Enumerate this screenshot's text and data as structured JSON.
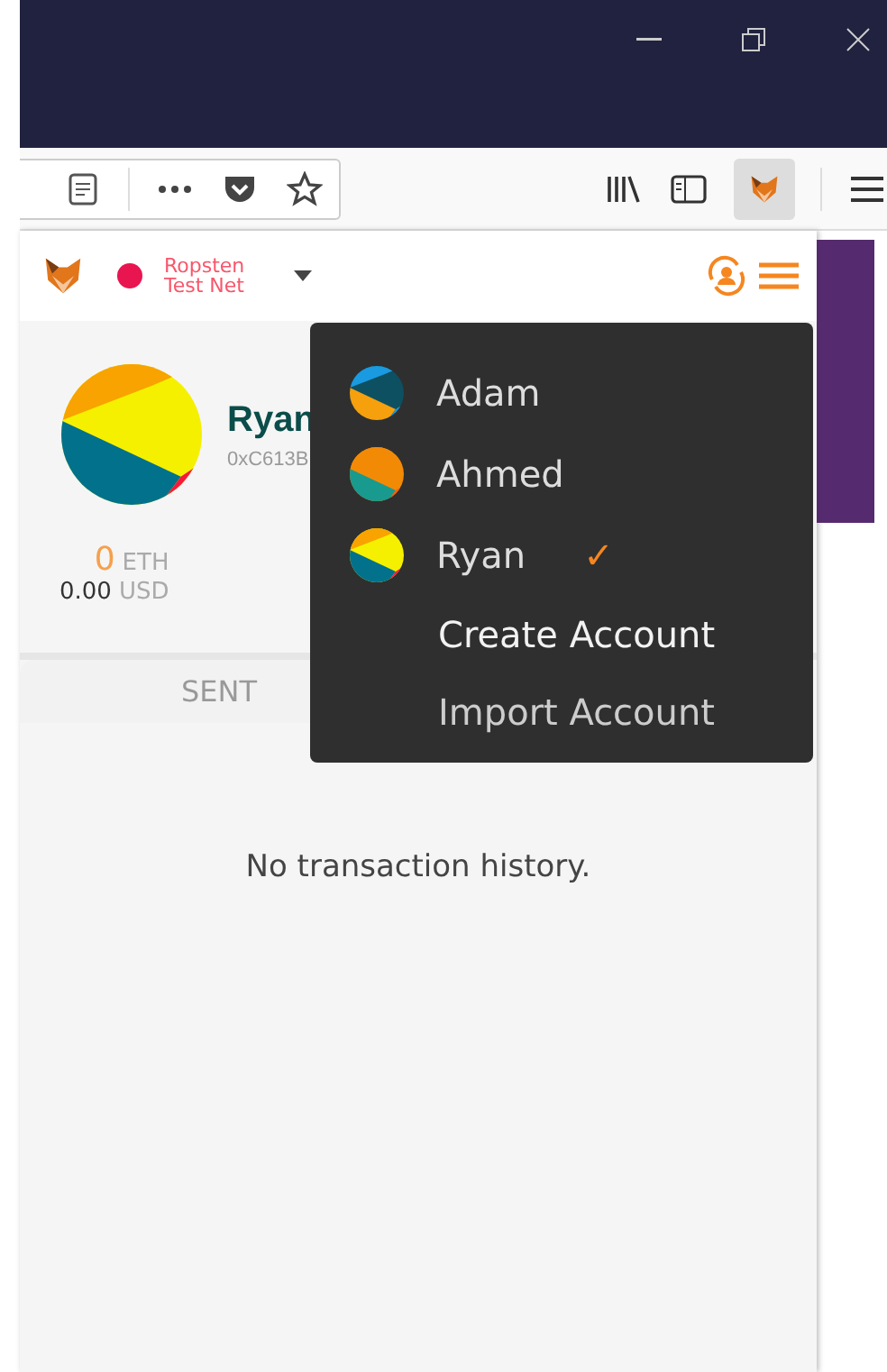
{
  "network": {
    "name": "Ropsten Test Net"
  },
  "account": {
    "name": "Ryan",
    "address": "0xC613B",
    "balance": "0",
    "unit": "ETH",
    "fiat": "0.00",
    "fiat_unit": "USD"
  },
  "tabs": [
    {
      "label": "SENT"
    }
  ],
  "empty_message": "No transaction history.",
  "account_menu": {
    "accounts": [
      {
        "name": "Adam",
        "selected": false
      },
      {
        "name": "Ahmed",
        "selected": false
      },
      {
        "name": "Ryan",
        "selected": true
      }
    ],
    "check": "✓",
    "actions": [
      "Create Account",
      "Import Account"
    ]
  }
}
